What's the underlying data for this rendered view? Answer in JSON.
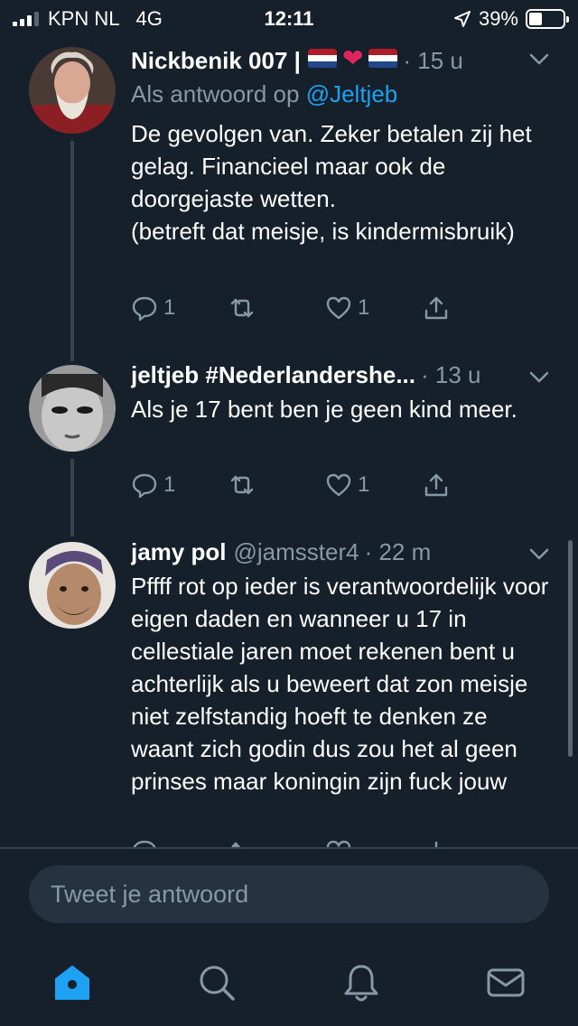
{
  "status_bar": {
    "carrier": "KPN NL",
    "network": "4G",
    "time": "12:11",
    "battery": "39%",
    "battery_level": 0.39
  },
  "tweets": [
    {
      "name": "Nickbenik 007 |",
      "time": "· 15 u",
      "reply_prefix": "Als antwoord op",
      "reply_mention": "@Jeltjeb",
      "text": "De gevolgen van. Zeker betalen zij het gelag. Financieel maar ook de doorgejaste wetten.\n(betreft dat meisje, is kindermisbruik)",
      "reply_count": "1",
      "like_count": "1",
      "icons": [
        "netherlands-flag-icon",
        "red-heart-icon",
        "netherlands-flag-icon"
      ]
    },
    {
      "name": "jeltjeb #Nederlandershe...",
      "time": "· 13 u",
      "text": "Als je 17 bent ben je geen kind meer.",
      "reply_count": "1",
      "like_count": "1"
    },
    {
      "name": "jamy pol",
      "handle": "@jamsster4",
      "time": "· 22 m",
      "text": "Pffff rot op ieder is verantwoordelijk voor eigen daden en wanneer u 17 in cellestiale jaren moet rekenen bent u achterlijk als u beweert dat zon meisje niet zelfstandig hoeft te denken ze waant zich godin dus zou het al geen prinses maar koningin zijn fuck jouw"
    }
  ],
  "compose": {
    "placeholder": "Tweet je antwoord"
  },
  "tabs": [
    "home-icon",
    "search-icon",
    "notifications-icon",
    "messages-icon"
  ],
  "colors": {
    "background": "#15202b",
    "accent": "#1da1f2",
    "secondary_text": "#8899a6",
    "input_bg": "#253341"
  }
}
